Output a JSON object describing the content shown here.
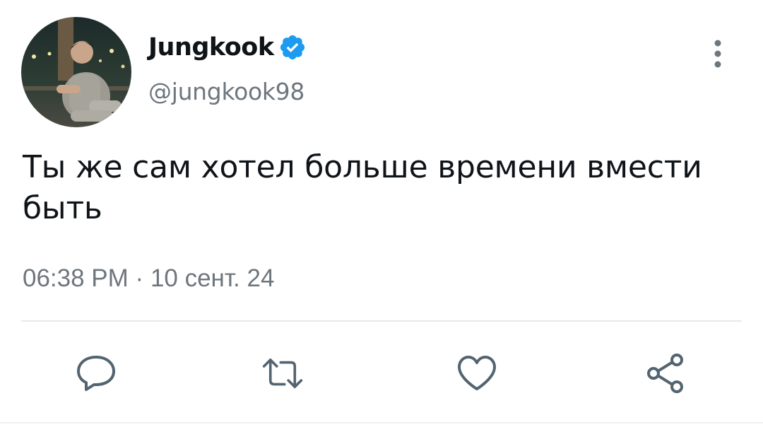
{
  "tweet": {
    "author": {
      "display_name": "Jungkook",
      "handle": "@jungkook98",
      "verified": true,
      "avatar_description_icon": "avatar-photo"
    },
    "text": "Ты же сам хотел больше времени вмести быть",
    "time": "06:38 PM",
    "separator": "·",
    "date": "10 сент. 24"
  },
  "actions": [
    {
      "name": "reply",
      "icon": "speech-bubble-icon"
    },
    {
      "name": "retweet",
      "icon": "retweet-icon"
    },
    {
      "name": "like",
      "icon": "heart-icon"
    },
    {
      "name": "share",
      "icon": "share-icon"
    }
  ],
  "menu": {
    "icon": "more-vertical-icon"
  },
  "colors": {
    "text": "#0f1419",
    "secondary": "#6e767d",
    "verified": "#1d9bf0",
    "divider": "#e6eaed",
    "icon": "#536471"
  }
}
